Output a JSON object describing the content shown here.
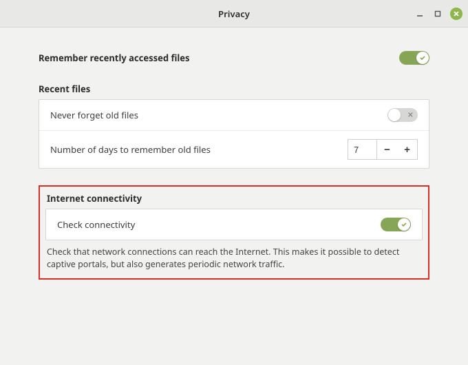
{
  "window": {
    "title": "Privacy"
  },
  "remember": {
    "label": "Remember recently accessed files",
    "value": true
  },
  "recent_files": {
    "heading": "Recent files",
    "never_forget": {
      "label": "Never forget old files",
      "value": false
    },
    "days_to_remember": {
      "label": "Number of days to remember old files",
      "value": "7"
    }
  },
  "internet": {
    "heading": "Internet connectivity",
    "check": {
      "label": "Check connectivity",
      "value": true
    },
    "description": "Check that network connections can reach the Internet. This makes it possible to detect captive portals, but also generates periodic network traffic."
  }
}
